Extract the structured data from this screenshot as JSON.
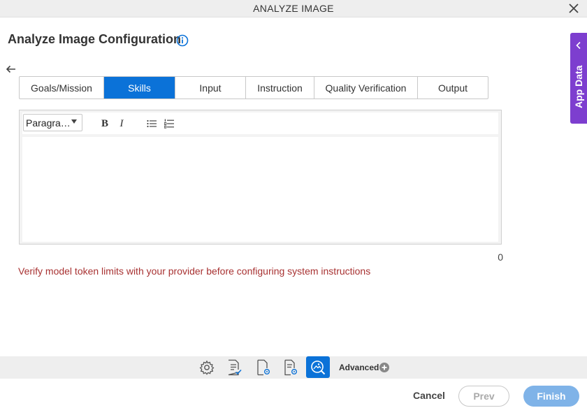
{
  "window": {
    "title": "ANALYZE IMAGE"
  },
  "page": {
    "heading": "Analyze Image Configuration"
  },
  "tabs": [
    {
      "label": "Goals/Mission"
    },
    {
      "label": "Skills"
    },
    {
      "label": "Input"
    },
    {
      "label": "Instruction"
    },
    {
      "label": "Quality Verification"
    },
    {
      "label": "Output"
    }
  ],
  "active_tab": "Skills",
  "editor": {
    "format_select": "Paragra…",
    "bold_label": "B",
    "italic_label": "I",
    "content": "",
    "char_count": "0"
  },
  "warning": "Verify model token limits with your provider before configuring system instructions",
  "side_panel": {
    "label": "App Data"
  },
  "bottom_bar": {
    "icons": [
      "gear-icon",
      "document-check-icon",
      "document-settings-icon",
      "document-gear-icon",
      "analyze-image-icon"
    ],
    "advanced_label": "Advanced"
  },
  "footer": {
    "cancel_label": "Cancel",
    "prev_label": "Prev",
    "finish_label": "Finish"
  },
  "colors": {
    "accent": "#0b72d8",
    "side_panel": "#7d3ecf",
    "warning": "#a83232",
    "finish_disabled": "#7fb3e8"
  }
}
